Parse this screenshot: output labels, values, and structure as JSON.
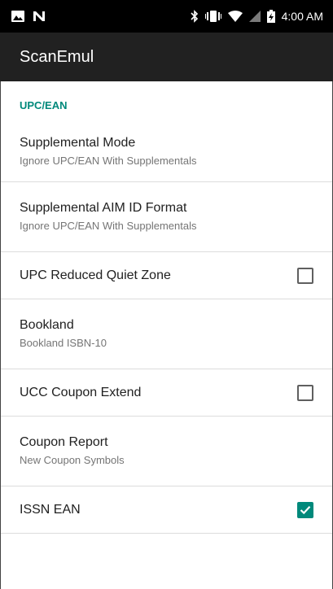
{
  "status_bar": {
    "time": "4:00 AM",
    "icons": [
      "image-icon",
      "n-icon",
      "bluetooth-icon",
      "vibrate-icon",
      "wifi-icon",
      "signal-icon",
      "battery-charging-icon"
    ]
  },
  "app_bar": {
    "title": "ScanEmul"
  },
  "category": {
    "title": "UPC/EAN"
  },
  "preferences": [
    {
      "title": "Supplemental Mode",
      "summary": "Ignore UPC/EAN With Supplementals"
    },
    {
      "title": "Supplemental AIM ID Format",
      "summary": "Ignore UPC/EAN With Supplementals"
    },
    {
      "title": "UPC Reduced Quiet Zone",
      "checked": false
    },
    {
      "title": "Bookland",
      "summary": "Bookland ISBN-10"
    },
    {
      "title": "UCC Coupon Extend",
      "checked": false
    },
    {
      "title": "Coupon Report",
      "summary": "New Coupon Symbols"
    },
    {
      "title": "ISSN EAN",
      "checked": true
    }
  ],
  "colors": {
    "accent": "#00897b",
    "appbar": "#212121",
    "statusbar": "#000000"
  }
}
